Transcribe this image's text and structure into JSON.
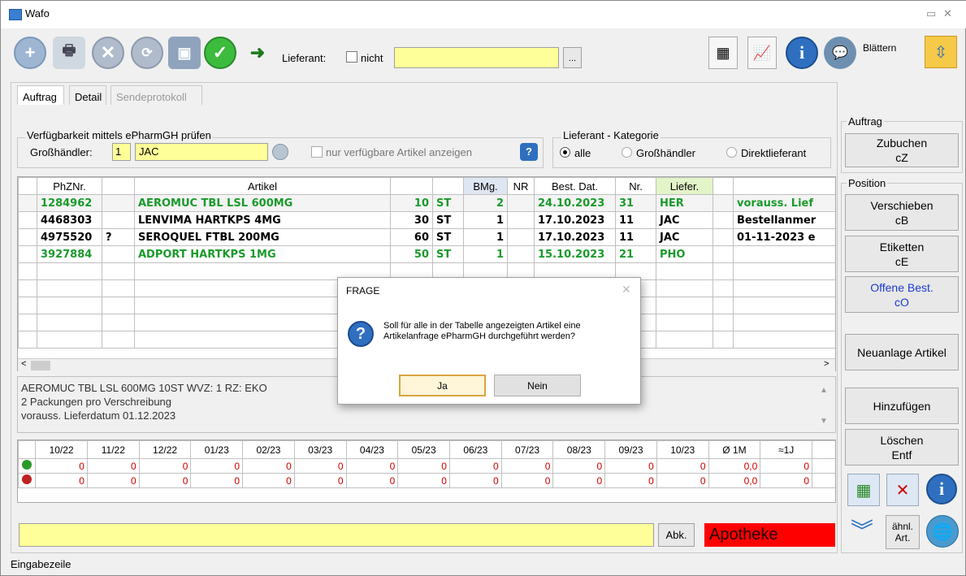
{
  "window": {
    "title": "Wafo"
  },
  "toolbar": {
    "lieferant_label": "Lieferant:",
    "nicht_label": "nicht",
    "lieferant_value": "",
    "browse_label": "...",
    "blaettern_label": "Blättern"
  },
  "tabs": [
    {
      "label": "Auftrag",
      "accel": "A"
    },
    {
      "label": "Detail",
      "accel": "D"
    },
    {
      "label": "Sendeprotokoll",
      "accel": "S"
    }
  ],
  "verfuegbarkeit": {
    "legend": "Verfügbarkeit mittels ePharmGH prüfen",
    "grosshaendler_label": "Großhändler:",
    "grosshaendler_num": "1",
    "grosshaendler_name": "JAC",
    "nur_verfuegbar_label": "nur verfügbare Artikel anzeigen"
  },
  "lieferant_kategorie": {
    "legend": "Lieferant - Kategorie",
    "options": [
      "alle",
      "Großhändler",
      "Direktlieferant"
    ],
    "selected": "alle"
  },
  "table": {
    "headers": [
      "",
      "PhZNr.",
      "",
      "Artikel",
      "",
      "",
      "BMg.",
      "NR",
      "Best. Dat.",
      "Nr.",
      "Liefer.",
      "",
      ""
    ],
    "rows": [
      {
        "phznr": "1284962",
        "flag": "",
        "artikel": "AEROMUC TBL LSL 600MG",
        "menge": "10",
        "einheit": "ST",
        "bmg": "2",
        "nr": "",
        "best_dat": "24.10.2023",
        "nr2": "31",
        "liefer": "HER",
        "info": "vorauss. Lief"
      },
      {
        "phznr": "4468303",
        "flag": "",
        "artikel": "LENVIMA HARTKPS  4MG",
        "menge": "30",
        "einheit": "ST",
        "bmg": "1",
        "nr": "",
        "best_dat": "17.10.2023",
        "nr2": "11",
        "liefer": "JAC",
        "info": "Bestellanmer"
      },
      {
        "phznr": "4975520",
        "flag": "?",
        "artikel": "SEROQUEL FTBL 200MG",
        "menge": "60",
        "einheit": "ST",
        "bmg": "1",
        "nr": "",
        "best_dat": "17.10.2023",
        "nr2": "11",
        "liefer": "JAC",
        "info": "01-11-2023 e"
      },
      {
        "phznr": "3927884",
        "flag": "",
        "artikel": "ADPORT HARTKPS 1MG",
        "menge": "50",
        "einheit": "ST",
        "bmg": "1",
        "nr": "",
        "best_dat": "15.10.2023",
        "nr2": "21",
        "liefer": "PHO",
        "info": ""
      }
    ]
  },
  "info_text": {
    "line1": "AEROMUC TBL LSL 600MG 10ST   WVZ: 1   RZ:   EKO",
    "line2": "2 Packungen pro Verschreibung",
    "line3": "vorauss. Lieferdatum 01.12.2023"
  },
  "stats": {
    "headers": [
      "10/22",
      "11/22",
      "12/22",
      "01/23",
      "02/23",
      "03/23",
      "04/23",
      "05/23",
      "06/23",
      "07/23",
      "08/23",
      "09/23",
      "10/23",
      "Ø 1M",
      "≈1J"
    ],
    "row_e": [
      "0",
      "0",
      "0",
      "0",
      "0",
      "0",
      "0",
      "0",
      "0",
      "0",
      "0",
      "0",
      "0",
      "0,0",
      "0"
    ],
    "row_v": [
      "0",
      "0",
      "0",
      "0",
      "0",
      "0",
      "0",
      "0",
      "0",
      "0",
      "0",
      "0",
      "0",
      "0,0",
      "0"
    ]
  },
  "bottom": {
    "input_value": "",
    "abk_label": "Abk.",
    "apotheke_label": "Apotheke",
    "status_label": "Eingabezeile"
  },
  "right_panel": {
    "auftrag_legend": "Auftrag",
    "zubuchen": [
      "Zubuchen",
      "cZ"
    ],
    "position_legend": "Position",
    "verschieben": [
      "Verschieben",
      "cB"
    ],
    "etiketten": [
      "Etiketten",
      "cE"
    ],
    "offene": [
      "Offene Best.",
      "cO"
    ],
    "neuanlage": "Neuanlage Artikel",
    "hinzufuegen": "Hinzufügen",
    "loeschen": [
      "Löschen",
      "Entf"
    ],
    "aehnl": [
      "ähnl.",
      "Art."
    ]
  },
  "dialog": {
    "title": "FRAGE",
    "message_line1": "Soll für alle in der Tabelle angezeigten Artikel eine",
    "message_line2": "Artikelanfrage ePharmGH durchgeführt werden?",
    "yes_label": "Ja",
    "no_label": "Nein"
  },
  "colors": {
    "green_text": "#1a9a2a",
    "apotheke_bg": "#ff0000",
    "input_yellow": "#ffff99"
  }
}
